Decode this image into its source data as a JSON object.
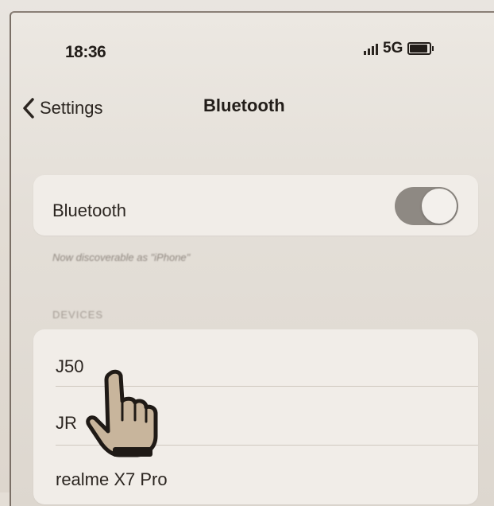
{
  "status_bar": {
    "time": "18:36",
    "network": "5G",
    "battery_level": 0.85
  },
  "nav": {
    "back_label": "Settings",
    "title": "Bluetooth"
  },
  "bluetooth": {
    "label": "Bluetooth",
    "enabled": true,
    "footnote": "Now discoverable as \"iPhone\""
  },
  "devices": {
    "header": "DEVICES",
    "items": [
      {
        "name": "J50"
      },
      {
        "name": "JR"
      },
      {
        "name": "realme X7 Pro"
      }
    ]
  },
  "colors": {
    "background": "#e4ded6",
    "card": "#f1ede8",
    "toggle_track": "#8e8983",
    "text": "#2b2520"
  },
  "icons": {
    "back": "chevron-left-icon",
    "pointer": "pointing-hand-icon",
    "signal": "signal-bars-icon",
    "battery": "battery-icon"
  }
}
